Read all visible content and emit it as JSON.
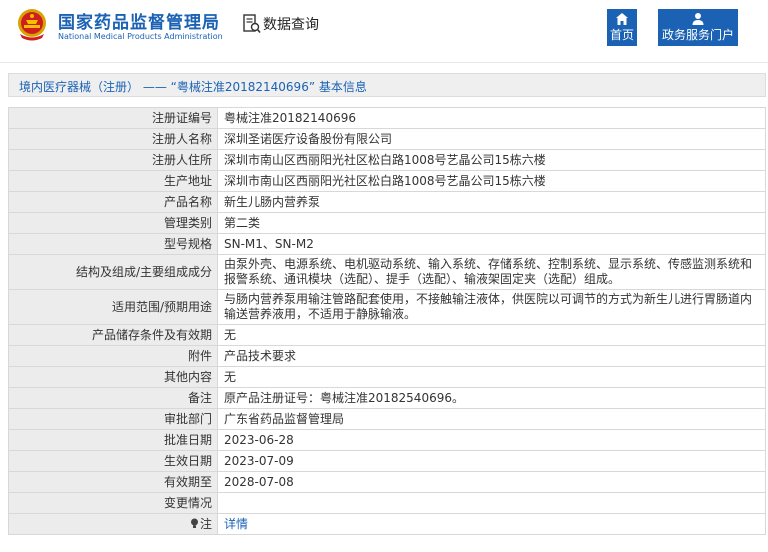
{
  "header": {
    "logo_cn": "国家药品监督管理局",
    "logo_en": "National Medical Products Administration",
    "query_title": "数据查询",
    "nav": [
      {
        "label": "首页",
        "icon": "home-icon"
      },
      {
        "label": "政务服务门户",
        "icon": "users-icon"
      }
    ]
  },
  "section": {
    "title": "境内医疗器械（注册） —— “粤械注准20182140696” 基本信息"
  },
  "rows": [
    {
      "label": "注册证编号",
      "value": "粤械注准20182140696"
    },
    {
      "label": "注册人名称",
      "value": "深圳圣诺医疗设备股份有限公司"
    },
    {
      "label": "注册人住所",
      "value": "深圳市南山区西丽阳光社区松白路1008号艺晶公司15栋六楼"
    },
    {
      "label": "生产地址",
      "value": "深圳市南山区西丽阳光社区松白路1008号艺晶公司15栋六楼"
    },
    {
      "label": "产品名称",
      "value": "新生儿肠内营养泵"
    },
    {
      "label": "管理类别",
      "value": "第二类"
    },
    {
      "label": "型号规格",
      "value": "SN-M1、SN-M2"
    },
    {
      "label": "结构及组成/主要组成成分",
      "value": "由泵外壳、电源系统、电机驱动系统、输入系统、存储系统、控制系统、显示系统、传感监测系统和报警系统、通讯模块（选配）、提手（选配）、输液架固定夹（选配）组成。"
    },
    {
      "label": "适用范围/预期用途",
      "value": "与肠内营养泵用输注管路配套使用，不接触输注液体，供医院以可调节的方式为新生儿进行胃肠道内输送营养液用，不适用于静脉输液。"
    },
    {
      "label": "产品储存条件及有效期",
      "value": "无"
    },
    {
      "label": "附件",
      "value": "产品技术要求"
    },
    {
      "label": "其他内容",
      "value": "无"
    },
    {
      "label": "备注",
      "value": "原产品注册证号：粤械注准20182540696。"
    },
    {
      "label": "审批部门",
      "value": "广东省药品监督管理局"
    },
    {
      "label": "批准日期",
      "value": "2023-06-28"
    },
    {
      "label": "生效日期",
      "value": "2023-07-09"
    },
    {
      "label": "有效期至",
      "value": "2028-07-08"
    },
    {
      "label": "变更情况",
      "value": ""
    },
    {
      "label": "注",
      "value": "详情"
    }
  ],
  "colors": {
    "brand": "#1b62b5",
    "label_bg": "#ececec",
    "border": "#d8d8d8"
  }
}
